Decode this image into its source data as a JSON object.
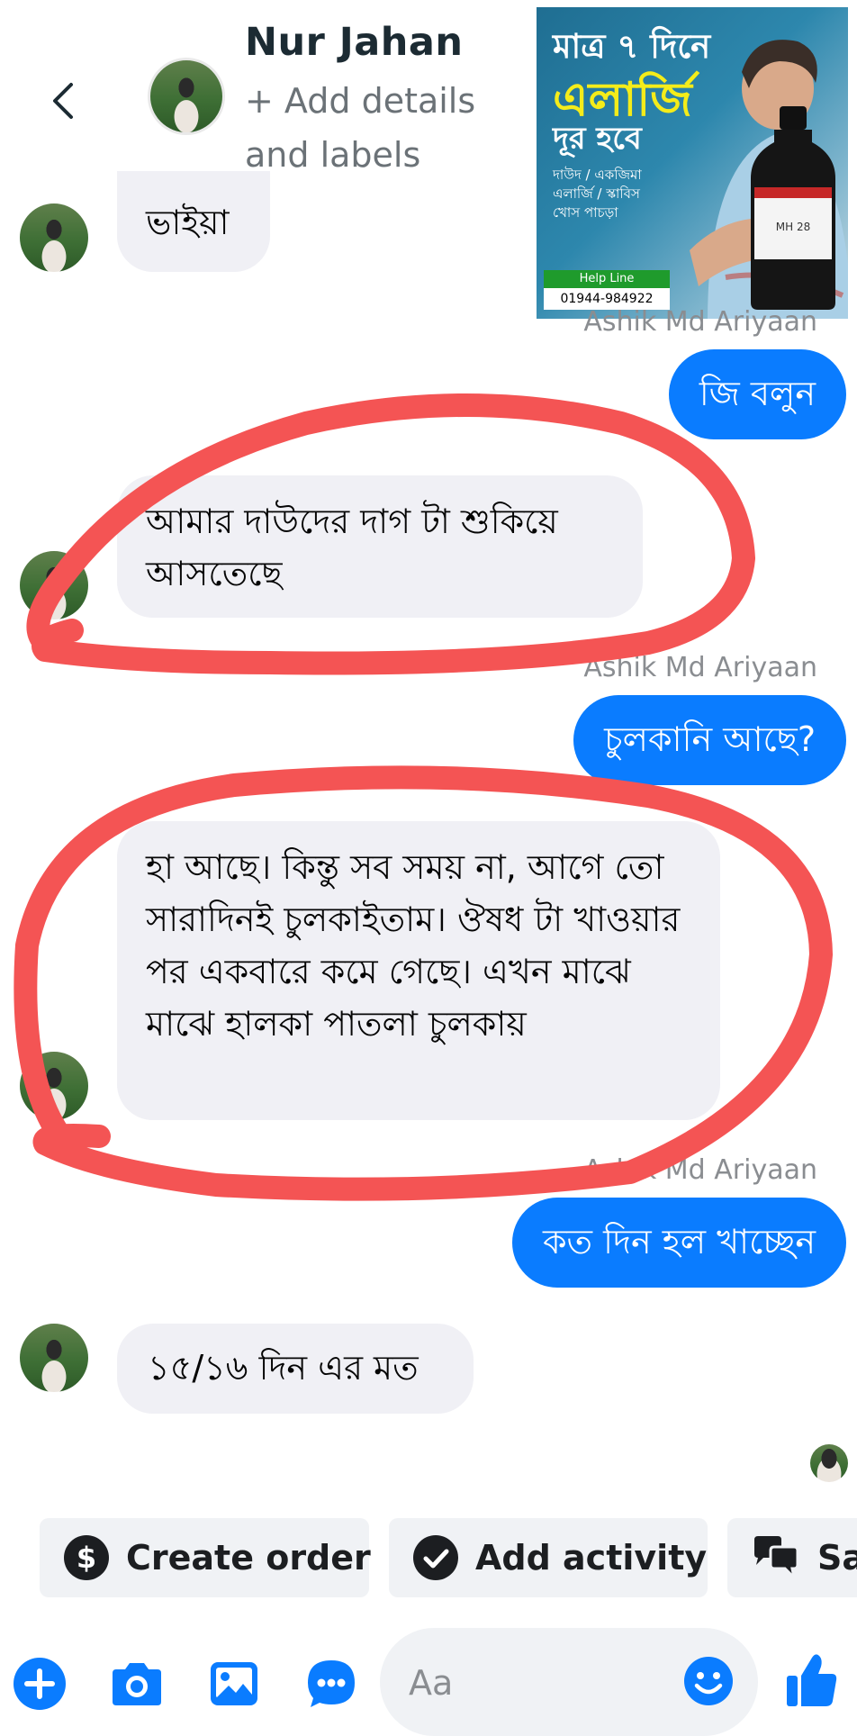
{
  "header": {
    "contact_name": "Nur Jahan",
    "subtitle": "+ Add details and labels"
  },
  "ad": {
    "line1": "মাত্র ৭ দিনে",
    "line2": "এলার্জি",
    "line3": "দূর হবে",
    "line4": "দাউদ / একজিমা এলার্জি / স্কাবিস খোস পাচড়া",
    "helpline_label": "Help Line",
    "helpline_phone": "01944-984922",
    "bottle_label": "MH 28"
  },
  "messages": [
    {
      "side": "incoming",
      "text": "ভাইয়া"
    },
    {
      "side": "sender_label",
      "text": "Ashik Md Ariyaan"
    },
    {
      "side": "outgoing",
      "text": "জি বলুন"
    },
    {
      "side": "incoming",
      "text": "আমার দাউদের দাগ টা শুকিয়ে আসতেছে"
    },
    {
      "side": "sender_label",
      "text": "Ashik Md Ariyaan"
    },
    {
      "side": "outgoing",
      "text": "চুলকানি আছে?"
    },
    {
      "side": "incoming",
      "text": "হা আছে। কিন্তু সব সময় না, আগে তো সারাদিনই চুলকাইতাম। ঔষধ টা খাওয়ার পর একবারে কমে গেছে। এখন মাঝে মাঝে হালকা পাতলা চুলকায়"
    },
    {
      "side": "sender_label",
      "text": "Ashik Md Ariyaan"
    },
    {
      "side": "outgoing",
      "text": "কত দিন হল খাচ্ছেন"
    },
    {
      "side": "incoming",
      "text": "১৫/১৬ দিন এর মত"
    }
  ],
  "quick_actions": [
    {
      "label": "Create order",
      "icon": "dollar-icon"
    },
    {
      "label": "Add activity",
      "icon": "check-circle-icon"
    },
    {
      "label": "Sa",
      "icon": "chat-bubbles-icon"
    }
  ],
  "composer": {
    "placeholder": "Aa",
    "accent": "#0a7cff"
  },
  "annotation_color": "#f45454"
}
